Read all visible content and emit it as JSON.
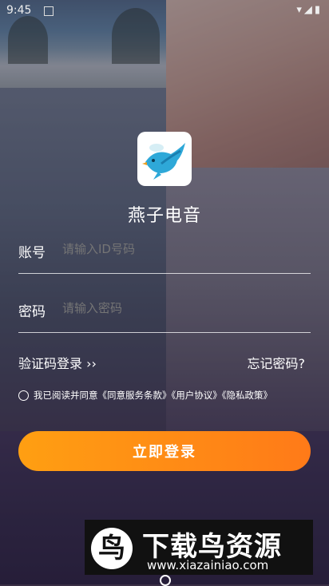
{
  "status_bar": {
    "time": "9:45",
    "icons": "▾◢▮"
  },
  "app": {
    "name": "燕子电音",
    "logo_icon": "swallow-bird-icon"
  },
  "account": {
    "label": "账号",
    "placeholder": "请输入ID号码"
  },
  "password": {
    "label": "密码",
    "placeholder": "请输入密码"
  },
  "links": {
    "sms_login": "验证码登录 ››",
    "forgot": "忘记密码?"
  },
  "agreement": {
    "text": "我已阅读并同意《同意服务条款》《用户协议》《隐私政策》",
    "checked": false
  },
  "login_button": {
    "label": "立即登录"
  },
  "watermark": {
    "glyph": "鸟",
    "title": "下载鸟资源",
    "url": "www.xiazainiao.com"
  },
  "colors": {
    "button_start": "#ff9f12",
    "button_end": "#ff7a18"
  }
}
